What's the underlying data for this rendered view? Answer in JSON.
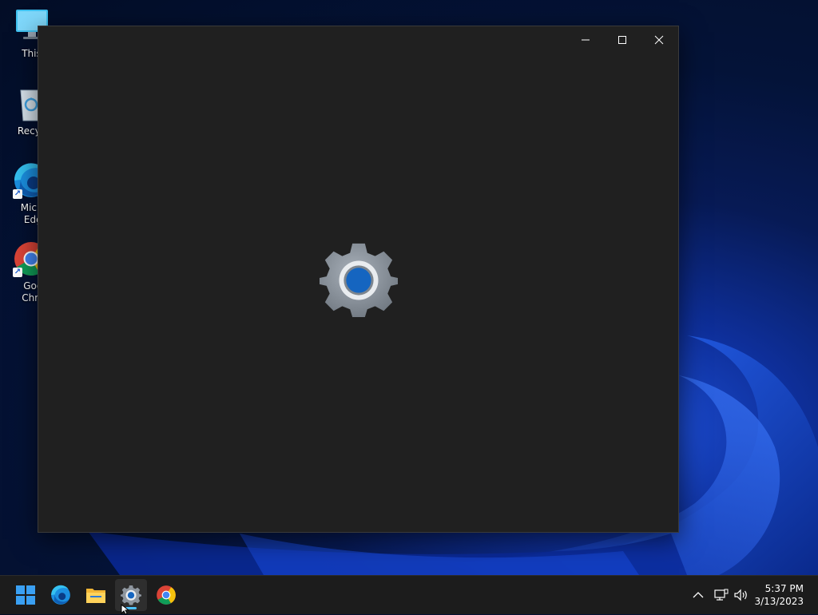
{
  "desktop": {
    "icons": [
      {
        "label": "This P",
        "icon": "monitor-icon"
      },
      {
        "label": "Recycle",
        "icon": "recycle-bin-icon"
      },
      {
        "label": "Micros\nEdge",
        "icon": "edge-icon"
      },
      {
        "label": "Goog\nChron",
        "icon": "chrome-icon"
      }
    ]
  },
  "window": {
    "app": "settings",
    "splash_icon": "gear-icon",
    "controls": [
      "minimize-icon",
      "maximize-icon",
      "close-icon"
    ]
  },
  "taskbar": {
    "apps": [
      {
        "name": "start",
        "icon": "windows-start-icon"
      },
      {
        "name": "edge",
        "icon": "edge-icon"
      },
      {
        "name": "file-explorer",
        "icon": "folder-icon"
      },
      {
        "name": "settings",
        "icon": "gear-icon",
        "active": true
      },
      {
        "name": "chrome",
        "icon": "chrome-icon"
      }
    ],
    "tray": [
      "chevron-up-icon",
      "network-icon",
      "volume-icon"
    ],
    "clock": {
      "time": "5:37 PM",
      "date": "3/13/2023"
    }
  },
  "colors": {
    "accent": "#4cc2ff",
    "window_bg": "#202020",
    "taskbar_bg": "#1c1c1c"
  }
}
